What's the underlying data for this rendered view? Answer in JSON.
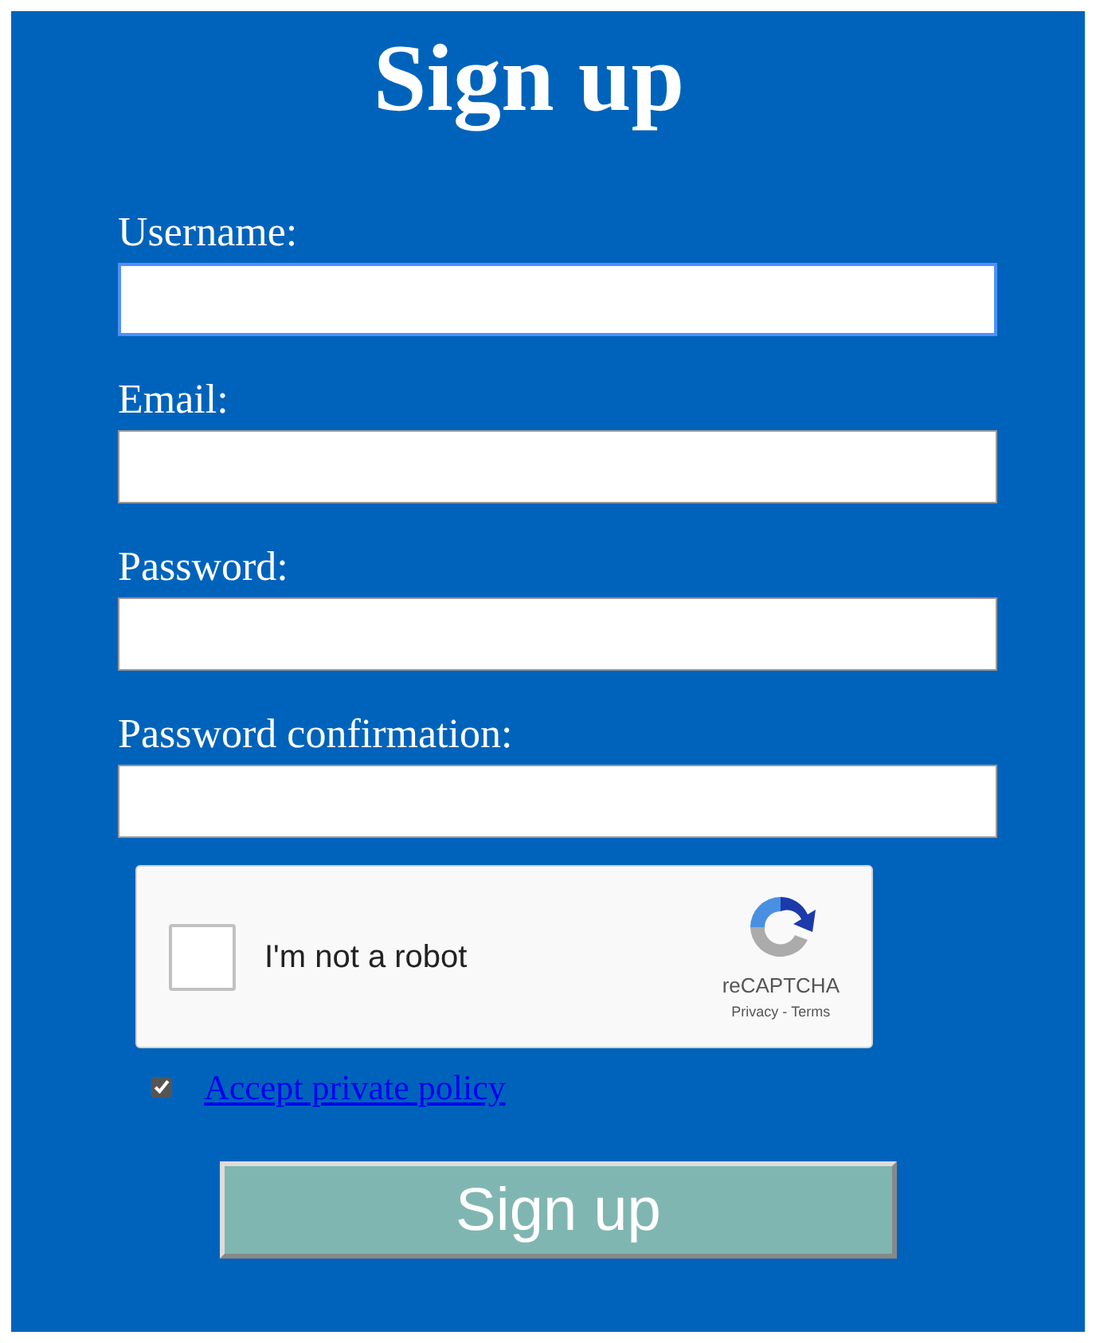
{
  "title": "Sign up",
  "fields": [
    {
      "label": "Username:",
      "focused": true
    },
    {
      "label": "Email:",
      "focused": false
    },
    {
      "label": "Password:",
      "focused": false
    },
    {
      "label": "Password confirmation:",
      "focused": false
    }
  ],
  "captcha": {
    "label": "I'm not a robot",
    "checked": false,
    "brand": "reCAPTCHA",
    "privacy": "Privacy",
    "separator": " - ",
    "terms": "Terms"
  },
  "policy": {
    "checked": true,
    "link": "Accept private policy"
  },
  "submit": "Sign up"
}
